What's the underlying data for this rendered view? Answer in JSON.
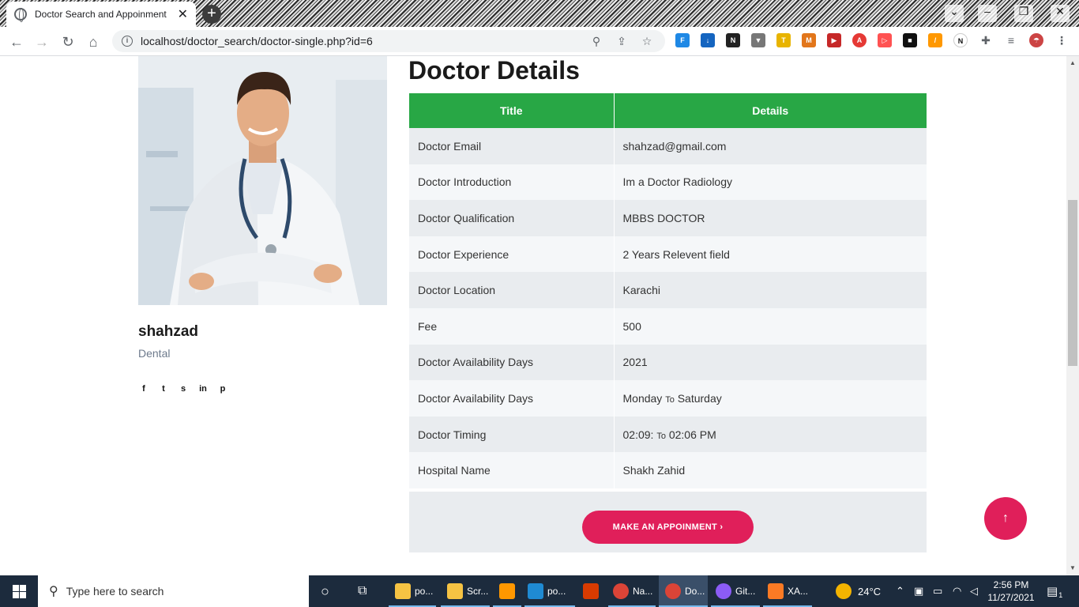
{
  "browser": {
    "tab_title": "Doctor Search and Appoinment",
    "tab_close": "✕",
    "new_tab": "+",
    "url": "localhost/doctor_search/doctor-single.php?id=6"
  },
  "doctor": {
    "name": "shahzad",
    "specialty": "Dental"
  },
  "social": [
    "f",
    "t",
    "s",
    "in",
    "p"
  ],
  "page": {
    "heading": "Doctor Details",
    "table_headers": [
      "Title",
      "Details"
    ],
    "rows": [
      {
        "title": "Doctor Email",
        "details": "shahzad@gmail.com"
      },
      {
        "title": "Doctor Introduction",
        "details": "Im a Doctor Radiology"
      },
      {
        "title": "Doctor Qualification",
        "details": "MBBS DOCTOR"
      },
      {
        "title": "Doctor Experience",
        "details": "2 Years Relevent field"
      },
      {
        "title": "Doctor Location",
        "details": "Karachi"
      },
      {
        "title": "Fee",
        "details": "500"
      },
      {
        "title": "Doctor Availability Days",
        "details": "2021"
      },
      {
        "title": "Doctor Availability Days",
        "details_start": "Monday ",
        "details_sep": "To",
        "details_end": " Saturday"
      },
      {
        "title": "Doctor Timing",
        "details_start": "02:09: ",
        "details_sep": "To",
        "details_end": " 02:06 PM"
      },
      {
        "title": "Hospital Name",
        "details": "Shakh Zahid"
      }
    ],
    "appointment_button": "MAKE AN APPOINMENT  ›",
    "to_top": "↑"
  },
  "taskbar": {
    "search_placeholder": "Type here to search",
    "items": [
      "po...",
      "Scr...",
      "po...",
      "Na...",
      "Do...",
      "Git...",
      "XA..."
    ],
    "temperature": "24°C",
    "time": "2:56 PM",
    "date": "11/27/2021",
    "notification_count": "1"
  },
  "colors": {
    "header_green": "#28a745",
    "accent_pink": "#e01f5a",
    "specialty_gray": "#6d7a8c"
  }
}
